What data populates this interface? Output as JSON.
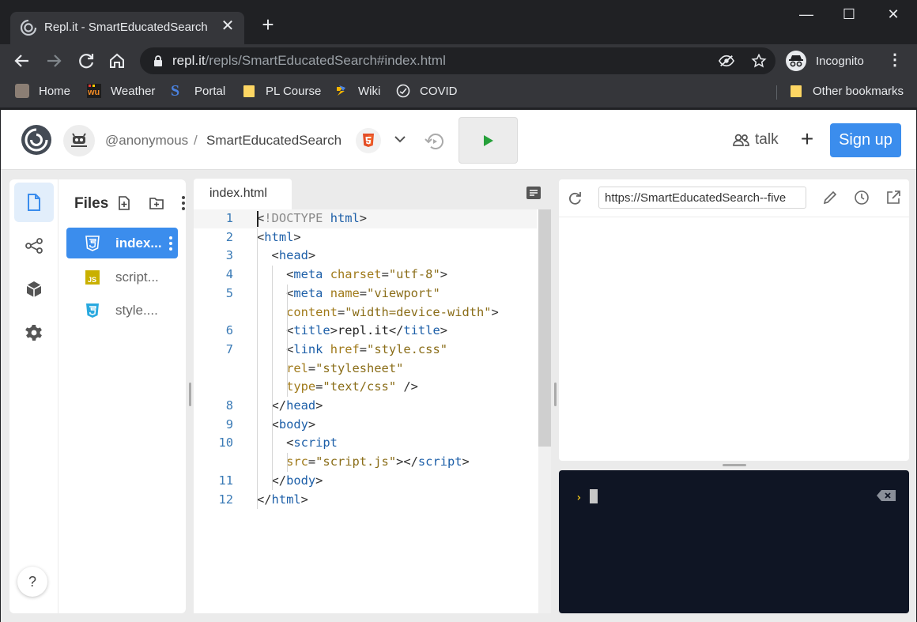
{
  "browser": {
    "tab_title": "Repl.it - SmartEducatedSearch",
    "new_tab": "+",
    "url_host": "repl.it",
    "url_path": "/repls/SmartEducatedSearch#index.html",
    "profile_label": "Incognito",
    "window_controls": {
      "minimize": "—",
      "maximize": "☐",
      "close": "✕"
    },
    "bookmarks": [
      "Home",
      "Weather",
      "Portal",
      "PL Course",
      "Wiki",
      "COVID"
    ],
    "other_bookmarks": "Other bookmarks"
  },
  "header": {
    "user": "@anonymous",
    "separator": "/",
    "repl_name": "SmartEducatedSearch",
    "talk_label": "talk",
    "plus": "+",
    "signup_label": "Sign up"
  },
  "files": {
    "title": "Files",
    "items": [
      {
        "name": "index...",
        "icon": "html5-icon",
        "active": true
      },
      {
        "name": "script...",
        "icon": "js-icon",
        "active": false
      },
      {
        "name": "style....",
        "icon": "css3-icon",
        "active": false
      }
    ]
  },
  "editor": {
    "tab": "index.html",
    "lines": [
      {
        "n": "1",
        "tokens": [
          [
            "t-punc",
            "<"
          ],
          [
            "t-doc",
            "!DOCTYPE "
          ],
          [
            "t-tag",
            "html"
          ],
          [
            "t-punc",
            ">"
          ]
        ]
      },
      {
        "n": "2",
        "tokens": [
          [
            "t-punc",
            "<"
          ],
          [
            "t-tag",
            "html"
          ],
          [
            "t-punc",
            ">"
          ]
        ]
      },
      {
        "n": "3",
        "tokens": [
          [
            "t-punc",
            "  <"
          ],
          [
            "t-tag",
            "head"
          ],
          [
            "t-punc",
            ">"
          ]
        ]
      },
      {
        "n": "4",
        "tokens": [
          [
            "t-punc",
            "    <"
          ],
          [
            "t-tag",
            "meta "
          ],
          [
            "t-attr",
            "charset"
          ],
          [
            "t-punc",
            "="
          ],
          [
            "t-str",
            "\"utf-8\""
          ],
          [
            "t-punc",
            ">"
          ]
        ]
      },
      {
        "n": "5",
        "tokens": [
          [
            "t-punc",
            "    <"
          ],
          [
            "t-tag",
            "meta "
          ],
          [
            "t-attr",
            "name"
          ],
          [
            "t-punc",
            "="
          ],
          [
            "t-str",
            "\"viewport\""
          ]
        ]
      },
      {
        "n": "",
        "tokens": [
          [
            "t-attr",
            "    content"
          ],
          [
            "t-punc",
            "="
          ],
          [
            "t-str",
            "\"width=device-width\""
          ],
          [
            "t-punc",
            ">"
          ]
        ]
      },
      {
        "n": "6",
        "tokens": [
          [
            "t-punc",
            "    <"
          ],
          [
            "t-tag",
            "title"
          ],
          [
            "t-punc",
            ">"
          ],
          [
            "t-txt",
            "repl.it"
          ],
          [
            "t-punc",
            "</"
          ],
          [
            "t-tag",
            "title"
          ],
          [
            "t-punc",
            ">"
          ]
        ]
      },
      {
        "n": "7",
        "tokens": [
          [
            "t-punc",
            "    <"
          ],
          [
            "t-tag",
            "link "
          ],
          [
            "t-attr",
            "href"
          ],
          [
            "t-punc",
            "="
          ],
          [
            "t-str",
            "\"style.css\""
          ]
        ]
      },
      {
        "n": "",
        "tokens": [
          [
            "t-attr",
            "    rel"
          ],
          [
            "t-punc",
            "="
          ],
          [
            "t-str",
            "\"stylesheet\""
          ]
        ]
      },
      {
        "n": "",
        "tokens": [
          [
            "t-attr",
            "    type"
          ],
          [
            "t-punc",
            "="
          ],
          [
            "t-str",
            "\"text/css\""
          ],
          [
            "t-punc",
            " />"
          ]
        ]
      },
      {
        "n": "8",
        "tokens": [
          [
            "t-punc",
            "  </"
          ],
          [
            "t-tag",
            "head"
          ],
          [
            "t-punc",
            ">"
          ]
        ]
      },
      {
        "n": "9",
        "tokens": [
          [
            "t-punc",
            "  <"
          ],
          [
            "t-tag",
            "body"
          ],
          [
            "t-punc",
            ">"
          ]
        ]
      },
      {
        "n": "10",
        "tokens": [
          [
            "t-punc",
            "    <"
          ],
          [
            "t-tag",
            "script"
          ]
        ]
      },
      {
        "n": "",
        "tokens": [
          [
            "t-attr",
            "    src"
          ],
          [
            "t-punc",
            "="
          ],
          [
            "t-str",
            "\"script.js\""
          ],
          [
            "t-punc",
            "></"
          ],
          [
            "t-tag",
            "script"
          ],
          [
            "t-punc",
            ">"
          ]
        ]
      },
      {
        "n": "11",
        "tokens": [
          [
            "t-punc",
            "  </"
          ],
          [
            "t-tag",
            "body"
          ],
          [
            "t-punc",
            ">"
          ]
        ]
      },
      {
        "n": "12",
        "tokens": [
          [
            "t-punc",
            "</"
          ],
          [
            "t-tag",
            "html"
          ],
          [
            "t-punc",
            ">"
          ]
        ]
      }
    ]
  },
  "preview": {
    "url": "https://SmartEducatedSearch--five"
  },
  "console": {
    "prompt": "›"
  },
  "help": "?",
  "colors": {
    "accent": "#3b8ded",
    "run_green": "#26a03a",
    "console_bg": "#0f1524"
  }
}
